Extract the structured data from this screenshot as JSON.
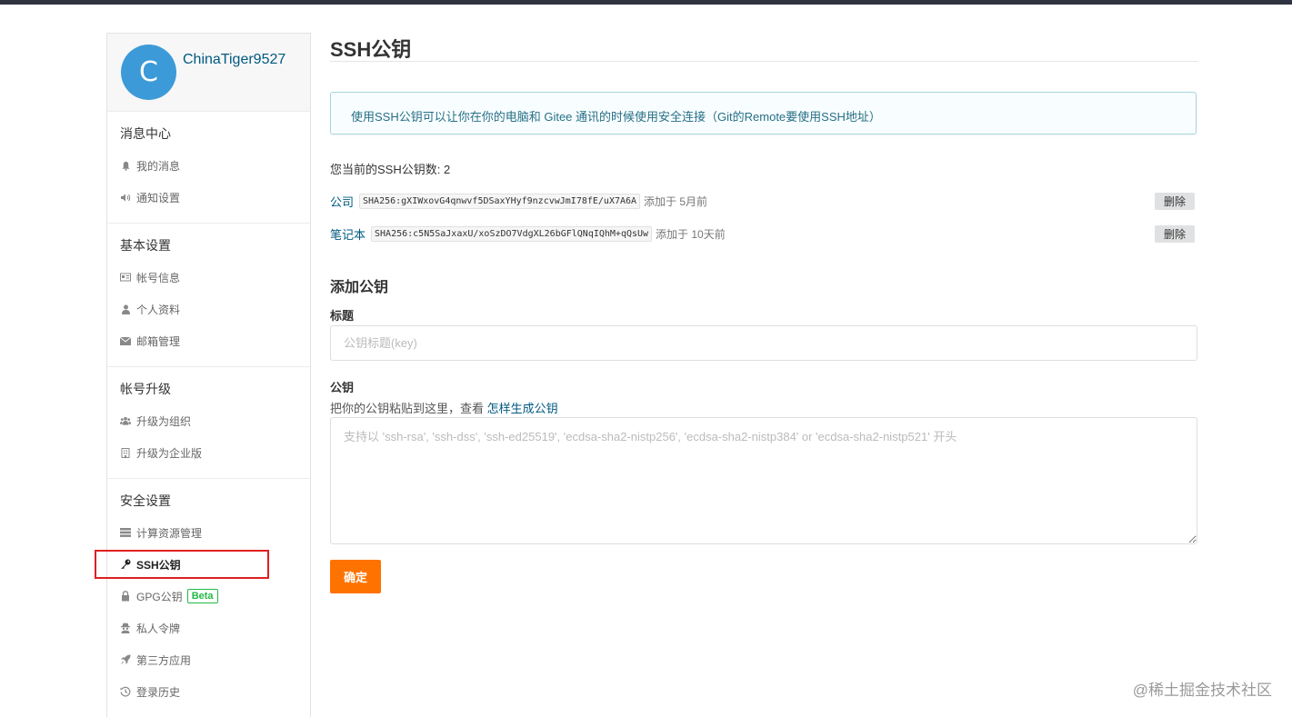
{
  "sidebar": {
    "avatar_letter": "C",
    "username": "ChinaTiger9527",
    "sections": [
      {
        "title": "消息中心",
        "items": [
          {
            "label": "我的消息",
            "icon": "bell-icon"
          },
          {
            "label": "通知设置",
            "icon": "volume-icon"
          }
        ]
      },
      {
        "title": "基本设置",
        "items": [
          {
            "label": "帐号信息",
            "icon": "id-card-icon"
          },
          {
            "label": "个人资料",
            "icon": "user-icon"
          },
          {
            "label": "邮箱管理",
            "icon": "envelope-icon"
          }
        ]
      },
      {
        "title": "帐号升级",
        "items": [
          {
            "label": "升级为组织",
            "icon": "users-icon"
          },
          {
            "label": "升级为企业版",
            "icon": "building-icon"
          }
        ]
      },
      {
        "title": "安全设置",
        "items": [
          {
            "label": "计算资源管理",
            "icon": "server-icon"
          },
          {
            "label": "SSH公钥",
            "icon": "key-icon",
            "active": true
          },
          {
            "label": "GPG公钥",
            "icon": "lock-icon",
            "badge": "Beta"
          },
          {
            "label": "私人令牌",
            "icon": "spy-icon"
          },
          {
            "label": "第三方应用",
            "icon": "rocket-icon"
          },
          {
            "label": "登录历史",
            "icon": "history-icon"
          }
        ]
      }
    ]
  },
  "main": {
    "title": "SSH公钥",
    "info": "使用SSH公钥可以让你在你的电脑和 Gitee 通讯的时候使用安全连接（Git的Remote要使用SSH地址）",
    "key_count_text": "您当前的SSH公钥数: 2",
    "keys": [
      {
        "name": "公司",
        "fingerprint": "SHA256:gXIWxovG4qnwvf5DSaxYHyf9nzcvwJmI78fE/uX7A6A",
        "added": "添加于 5月前",
        "delete_label": "删除"
      },
      {
        "name": "笔记本",
        "fingerprint": "SHA256:c5N5SaJxaxU/xoSzDO7VdgXL26bGFlQNqIQhM+qQsUw",
        "added": "添加于 10天前",
        "delete_label": "删除"
      }
    ],
    "add_title": "添加公钥",
    "title_label": "标题",
    "title_placeholder": "公钥标题(key)",
    "key_label": "公钥",
    "key_hint": "把你的公钥粘贴到这里，查看 ",
    "key_hint_link": "怎样生成公钥",
    "key_placeholder": "支持以 'ssh-rsa', 'ssh-dss', 'ssh-ed25519', 'ecdsa-sha2-nistp256', 'ecdsa-sha2-nistp384' or 'ecdsa-sha2-nistp521' 开头",
    "submit_label": "确定"
  },
  "watermark": "@稀土掘金技术社区",
  "colors": {
    "accent": "#fe7300",
    "link": "#005980",
    "avatar": "#3d9ad8",
    "highlight_box": "#e02020",
    "beta": "#21ba45"
  }
}
